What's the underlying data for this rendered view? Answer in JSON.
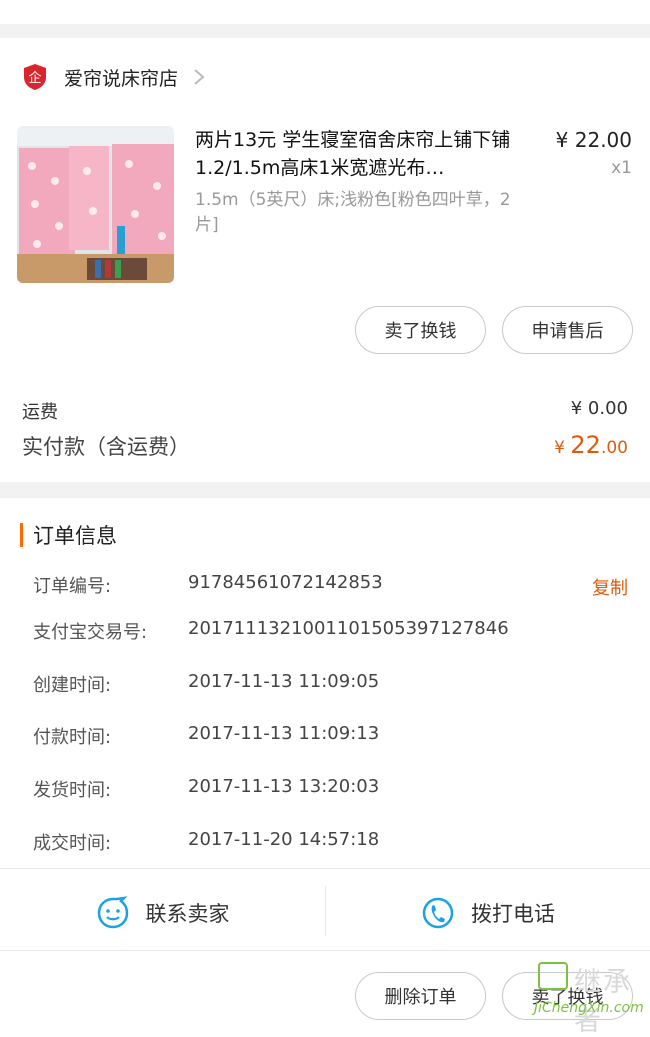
{
  "shop": {
    "name": "爱帘说床帘店",
    "badge_char": "企"
  },
  "item": {
    "title": "两片13元 学生寝室宿舍床帘上铺下铺1.2/1.5m高床1米宽遮光布…",
    "spec": "1.5m（5英尺）床;浅粉色[粉色四叶草，2片]",
    "price": "¥ 22.00",
    "qty": "x1"
  },
  "actions": {
    "sell": "卖了换钱",
    "after_sale": "申请售后"
  },
  "cost": {
    "shipping_label": "运费",
    "shipping_value": "¥ 0.00",
    "paid_label": "实付款（含运费）",
    "paid_symbol": "¥ ",
    "paid_int": "22",
    "paid_dec": ".00"
  },
  "order": {
    "section_title": "订单信息",
    "copy": "复制",
    "rows": [
      {
        "label": "订单编号:",
        "value": "91784561072142853"
      },
      {
        "label": "支付宝交易号:",
        "value": "2017111321001101505397127846"
      },
      {
        "label": "创建时间:",
        "value": "2017-11-13 11:09:05"
      },
      {
        "label": "付款时间:",
        "value": "2017-11-13 11:09:13"
      },
      {
        "label": "发货时间:",
        "value": "2017-11-13 13:20:03"
      },
      {
        "label": "成交时间:",
        "value": "2017-11-20 14:57:18"
      }
    ]
  },
  "contact": {
    "seller": "联系卖家",
    "call": "拨打电话"
  },
  "bottom": {
    "delete": "删除订单",
    "sell": "卖了换钱"
  },
  "watermark": {
    "text": "继承者",
    "url": "JiChengXin.com"
  },
  "colors": {
    "accent": "#ff6a00",
    "price_orange": "#e05a0c",
    "icon_blue": "#1aa1e6",
    "badge_red": "#d9262c"
  }
}
